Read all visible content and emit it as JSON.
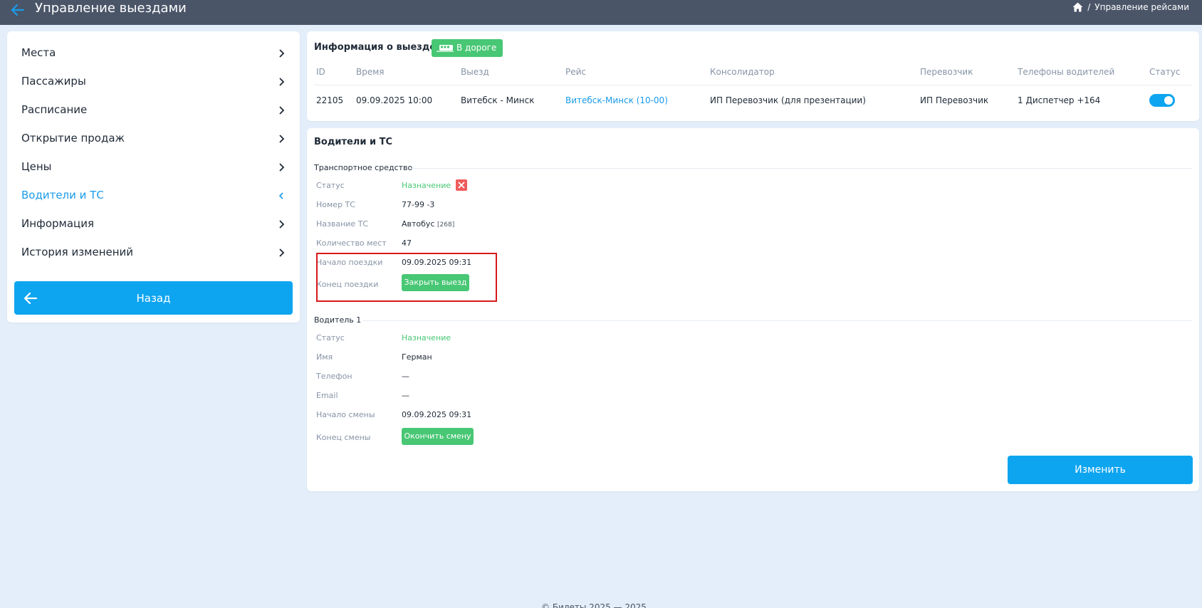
{
  "header": {
    "title": "Управление выездами",
    "breadcrumb": "Управление рейсами",
    "breadcrumb_sep": "/"
  },
  "sidebar": {
    "items": [
      {
        "label": "Места"
      },
      {
        "label": "Пассажиры"
      },
      {
        "label": "Расписание"
      },
      {
        "label": "Открытие продаж"
      },
      {
        "label": "Цены"
      },
      {
        "label": "Водители и ТС",
        "active": true
      },
      {
        "label": "Информация"
      },
      {
        "label": "История изменений"
      }
    ],
    "back_label": "Назад"
  },
  "trip_info": {
    "title": "Информация о выезде",
    "status_badge": "В дороге",
    "columns": [
      "ID",
      "Время",
      "Выезд",
      "Рейс",
      "Консолидатор",
      "Перевозчик",
      "Телефоны водителей",
      "Статус"
    ],
    "row": {
      "id": "22105",
      "time": "09.09.2025 10:00",
      "departure": "Витебск - Минск",
      "route": "Витебск-Минск (10-00)",
      "consolidator": "ИП Перевозчик (для презентации)",
      "carrier": "ИП Перевозчик",
      "phones": "1 Диспетчер +164",
      "status_on": true
    }
  },
  "drivers": {
    "title": "Водители и ТС",
    "vehicle": {
      "section": "Транспортное средство",
      "status_label": "Статус",
      "status_value": "Назначение",
      "number_label": "Номер ТС",
      "number_value": "77-99 -3",
      "name_label": "Название ТС",
      "name_value": "Автобус",
      "name_id": "[268]",
      "seats_label": "Количество мест",
      "seats_value": "47",
      "start_label": "Начало поездки",
      "start_value": "09.09.2025 09:31",
      "end_label": "Конец поездки",
      "end_button": "Закрыть выезд"
    },
    "driver1": {
      "section": "Водитель 1",
      "status_label": "Статус",
      "status_value": "Назначение",
      "name_label": "Имя",
      "name_value": "Герман",
      "phone_label": "Телефон",
      "phone_value": "—",
      "email_label": "Email",
      "email_value": "—",
      "shift_start_label": "Начало смены",
      "shift_start_value": "09.09.2025 09:31",
      "shift_end_label": "Конец смены",
      "shift_end_button": "Окончить смену"
    },
    "change_button": "Изменить"
  },
  "footer": {
    "text": "© Билеты 2025 — 2025"
  },
  "colors": {
    "topbar": "#4a5568",
    "accent": "#0ea5f0",
    "green": "#48c774",
    "danger": "#f05c5c",
    "highlight_border": "#d7191c"
  }
}
